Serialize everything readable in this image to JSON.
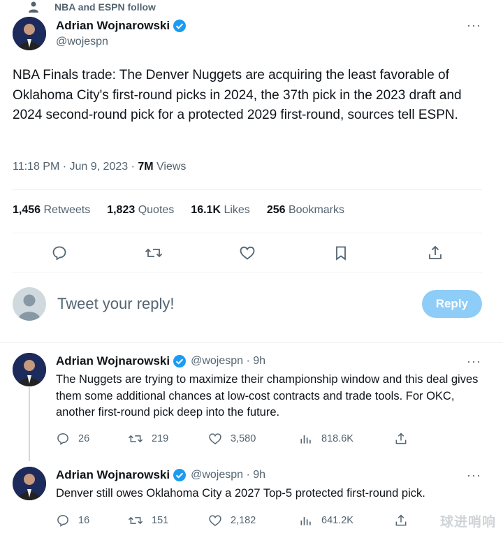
{
  "social_context": "NBA and ESPN follow",
  "main_tweet": {
    "author_name": "Adrian Wojnarowski",
    "author_handle": "@wojespn",
    "text": "NBA Finals trade: The Denver Nuggets are acquiring the least favorable of Oklahoma City's first-round picks in 2024, the 37th pick in the 2023 draft and 2024 second-round pick for a protected 2029 first-round, sources tell ESPN.",
    "time": "11:18 PM · Jun 9, 2023 · ",
    "views_count": "7M",
    "views_label": " Views",
    "stats": {
      "retweets_count": "1,456",
      "retweets_label": "Retweets",
      "quotes_count": "1,823",
      "quotes_label": "Quotes",
      "likes_count": "16.1K",
      "likes_label": "Likes",
      "bookmarks_count": "256",
      "bookmarks_label": "Bookmarks"
    }
  },
  "reply_box": {
    "placeholder": "Tweet your reply!",
    "button_label": "Reply"
  },
  "replies": [
    {
      "author_name": "Adrian Wojnarowski",
      "author_handle": "@wojespn · 9h",
      "text": "The Nuggets are trying to maximize their championship window and this deal gives them some additional chances at low-cost contracts and trade tools. For OKC, another first-round pick deep into the future.",
      "replies": "26",
      "retweets": "219",
      "likes": "3,580",
      "views": "818.6K"
    },
    {
      "author_name": "Adrian Wojnarowski",
      "author_handle": "@wojespn · 9h",
      "text": "Denver still owes Oklahoma City a 2027 Top-5 protected first-round pick.",
      "replies": "16",
      "retweets": "151",
      "likes": "2,182",
      "views": "641.2K"
    }
  ],
  "more_label": "···",
  "watermark": "球进哨响",
  "colors": {
    "accent": "#1d9bf0",
    "muted": "#536471",
    "reply_button": "#8ecdf7"
  }
}
